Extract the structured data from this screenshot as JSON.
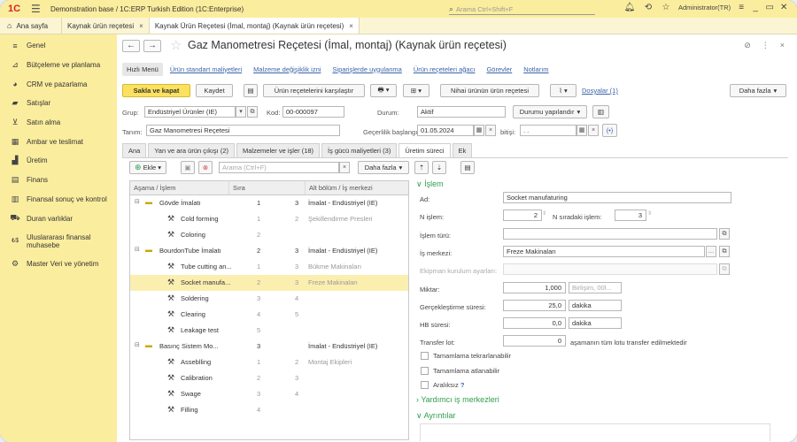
{
  "titlebar": {
    "logo": "1С",
    "title": "Demonstration base / 1C:ERP Turkish Edition (1C:Enterprise)",
    "search_placeholder": "Arama Ctrl+Shift+F",
    "user": "Administrator(TR)"
  },
  "tabs": {
    "home": "Ana sayfa",
    "items": [
      "Kaynak ürün reçetesi",
      "Kaynak Ürün Reçetesi (İmal, montaj) (Kaynak ürün reçetesi)"
    ]
  },
  "sidebar": {
    "items": [
      {
        "label": "Genel",
        "icon": "list-icon"
      },
      {
        "label": "Bütçeleme ve planlama",
        "icon": "chart-icon"
      },
      {
        "label": "CRM ve pazarlama",
        "icon": "pie-icon"
      },
      {
        "label": "Satışlar",
        "icon": "bag-icon"
      },
      {
        "label": "Satın alma",
        "icon": "cart-icon"
      },
      {
        "label": "Ambar ve teslimat",
        "icon": "grid-icon"
      },
      {
        "label": "Üretim",
        "icon": "factory-icon"
      },
      {
        "label": "Finans",
        "icon": "document-icon"
      },
      {
        "label": "Finansal sonuç ve kontrol",
        "icon": "finance-icon"
      },
      {
        "label": "Duran varlıklar",
        "icon": "car-icon"
      },
      {
        "label": "Uluslararası finansal muhasebe",
        "icon": "currency-icon"
      },
      {
        "label": "Master Veri ve yönetim",
        "icon": "gear-icon"
      }
    ]
  },
  "header": {
    "title": "Gaz Manometresi Reçetesi (İmal, montaj) (Kaynak ürün reçetesi)"
  },
  "links": [
    "Hızlı Menü",
    "Ürün standart maliyetleri",
    "Malzeme değişiklik izni",
    "Siparişlerde uygulanma",
    "Ürün reçeteleri ağacı",
    "Görevler",
    "Notlarım"
  ],
  "toolbar": {
    "save_close": "Sakla ve kapat",
    "save": "Kaydet",
    "compare": "Ürün reçetelerini karşılaştır",
    "final_product": "Nihai ürünün ürün reçetesi",
    "files": "Dosyalar (1)",
    "more": "Daha fazla"
  },
  "form": {
    "group_label": "Grup:",
    "group_value": "Endüstriyel Ürünler (IE)",
    "code_label": "Kod:",
    "code_value": "00-000097",
    "status_label": "Durum:",
    "status_value": "Aktif",
    "status_button": "Durumu yapılandır",
    "definition_label": "Tanım:",
    "definition_value": "Gaz Manometresi Reçetesi",
    "validity_label": "Geçerlilik başlangıcı:",
    "validity_value": "01.05.2024",
    "end_label": "bitişi:",
    "end_value": ". ."
  },
  "inner_tabs": [
    "Ana",
    "Yan ve ara ürün çıkışı (2)",
    "Malzemeler ve işler (18)",
    "İş gücü maliyetleri (3)",
    "Üretim süreci",
    "Ek"
  ],
  "stage_toolbar": {
    "add": "Ekle",
    "search_placeholder": "Arama (Ctrl+F)",
    "more": "Daha fazla"
  },
  "tree": {
    "headers": [
      "Aşama / İşlem",
      "Sıra",
      "Alt bölüm / İş merkezi"
    ],
    "rows": [
      {
        "name": "Gövde İmalatı",
        "seq": "1",
        "ord": "3",
        "dept": "İmalat - Endüstriyel (IE)",
        "level": 0
      },
      {
        "name": "Cold forming",
        "seq": "1",
        "ord": "2",
        "dept": "Şekillendirme Presleri",
        "level": 1
      },
      {
        "name": "Coloring",
        "seq": "2",
        "ord": "",
        "dept": "",
        "level": 1
      },
      {
        "name": "BourdonTube İmalatı",
        "seq": "2",
        "ord": "3",
        "dept": "İmalat - Endüstriyel (IE)",
        "level": 0
      },
      {
        "name": "Tube cutting an...",
        "seq": "1",
        "ord": "3",
        "dept": "Bükme Makinaları",
        "level": 1
      },
      {
        "name": "Socket manufa...",
        "seq": "2",
        "ord": "3",
        "dept": "Freze Makinaları",
        "level": 1,
        "selected": true
      },
      {
        "name": "Soldering",
        "seq": "3",
        "ord": "4",
        "dept": "",
        "level": 1
      },
      {
        "name": "Clearing",
        "seq": "4",
        "ord": "5",
        "dept": "",
        "level": 1
      },
      {
        "name": "Leakage test",
        "seq": "5",
        "ord": "",
        "dept": "",
        "level": 1
      },
      {
        "name": "Basınç Sistem Mo...",
        "seq": "3",
        "ord": "",
        "dept": "İmalat - Endüstriyel (IE)",
        "level": 0
      },
      {
        "name": "Asseblling",
        "seq": "1",
        "ord": "2",
        "dept": "Montaj Ekipleri",
        "level": 1
      },
      {
        "name": "Calibration",
        "seq": "2",
        "ord": "3",
        "dept": "",
        "level": 1
      },
      {
        "name": "Swage",
        "seq": "3",
        "ord": "4",
        "dept": "",
        "level": 1
      },
      {
        "name": "Filling",
        "seq": "4",
        "ord": "",
        "dept": "",
        "level": 1
      }
    ]
  },
  "operation": {
    "section": "İşlem",
    "name_label": "Ad:",
    "name_value": "Socket manufaturing",
    "n_label": "N işlem:",
    "n_value": "2",
    "next_label": "N sıradaki işlem:",
    "next_value": "3",
    "type_label": "İşlem türü:",
    "center_label": "İş merkezi:",
    "center_value": "Freze Makinaları",
    "equipment_label": "Ekipman kurulum ayarları:",
    "qty_label": "Miktar:",
    "qty_value": "1,000",
    "qty_unit_placeholder": "Birlişim, 00l...",
    "exec_label": "Gerçekleştirme süresi:",
    "exec_value": "25,0",
    "exec_unit": "dakika",
    "hb_label": "HB süresi:",
    "hb_value": "0,0",
    "hb_unit": "dakika",
    "transfer_label": "Transfer lot:",
    "transfer_value": "0",
    "transfer_text": "aşamanın tüm lotu transfer edilmektedir",
    "repeat_label": "Tamamlama tekrarlanabilir",
    "skip_label": "Tamamlama atlanabilir",
    "gapless_label": "Aralıksız",
    "help": "?",
    "aux_section": "Yardımcı iş merkezleri",
    "details_section": "Ayrıntılar"
  },
  "colors": {
    "sidebar": "#fbed9e",
    "primary_button": "#fbe15f",
    "selection": "#fbefb0",
    "section_green": "#2f9e4e",
    "link": "#3b64a8"
  }
}
